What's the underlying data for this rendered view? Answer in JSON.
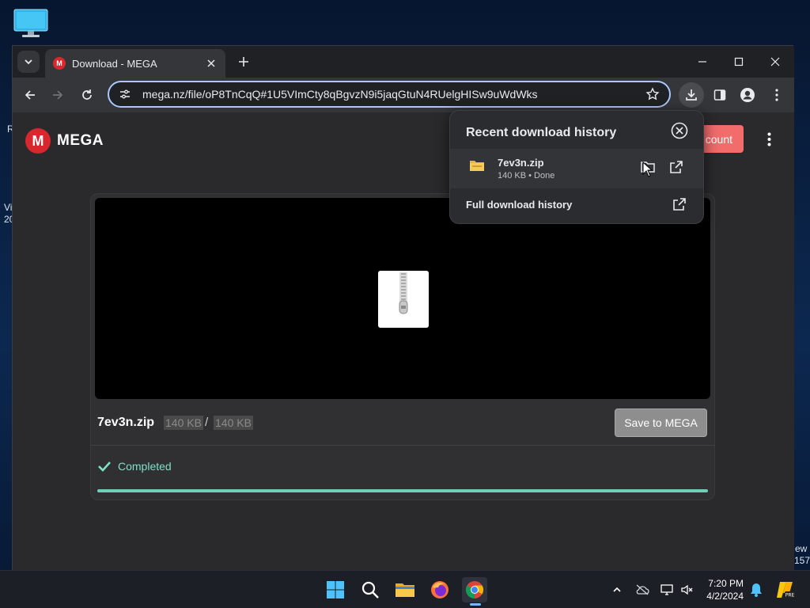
{
  "desktop": {
    "edge_left": [
      "R",
      "Vi",
      "20"
    ],
    "edge_right": [
      "ew",
      "157"
    ]
  },
  "browser": {
    "tab_title": "Download - MEGA",
    "tab_favicon_letter": "M",
    "url": "mega.nz/file/oP8TnCqQ#1U5VImCty8qBgvzN9i5jaqGtuN4RUelgHISw9uWdWks"
  },
  "mega": {
    "logo_letter": "M",
    "logo_text": "MEGA",
    "account_button": "count"
  },
  "file_card": {
    "filename": "7ev3n.zip",
    "downloaded_size": "140 KB",
    "separator": "/",
    "total_size": "140 KB",
    "save_button": "Save to MEGA",
    "status": "Completed",
    "progress_fraction": 1.0
  },
  "download_popup": {
    "title": "Recent download history",
    "item": {
      "name": "7ev3n.zip",
      "meta": "140 KB • Done"
    },
    "full_history": "Full download history"
  },
  "taskbar": {
    "time": "7:20 PM",
    "date": "4/2/2024",
    "apps": [
      "windows-start-icon",
      "search-icon",
      "file-explorer-icon",
      "firefox-icon",
      "chrome-icon"
    ]
  },
  "colors": {
    "mega_red": "#d9272e",
    "completed_green": "#7fe0c8",
    "focus_blue": "#a8c7fa"
  }
}
